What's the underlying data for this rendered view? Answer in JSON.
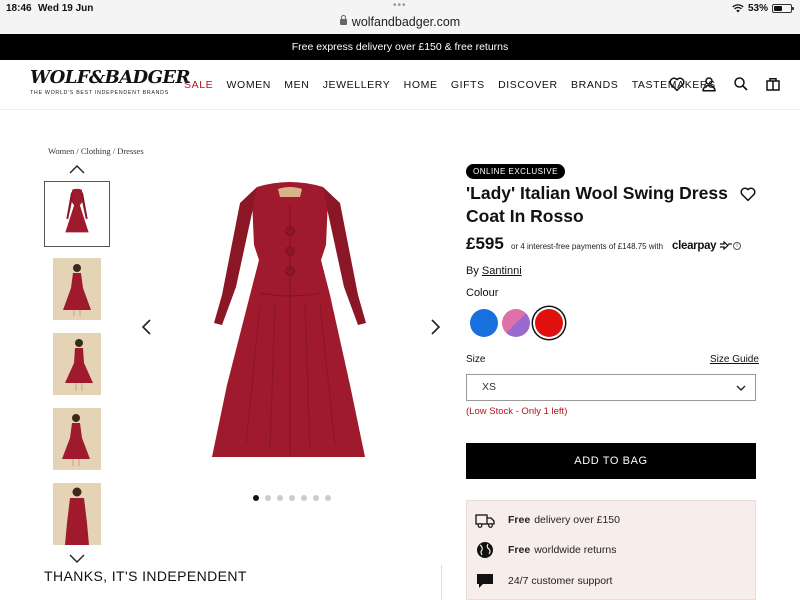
{
  "status_bar": {
    "time": "18:46",
    "date": "Wed 19 Jun",
    "url": "wolfandbadger.com",
    "battery": "53%",
    "battery_level": 0.53
  },
  "promo": {
    "text": "Free express delivery over £150 & free returns"
  },
  "header": {
    "logo": "WOLF&BADGER",
    "tagline": "THE WORLD'S BEST INDEPENDENT BRANDS",
    "nav": [
      "SALE",
      "WOMEN",
      "MEN",
      "JEWELLERY",
      "HOME",
      "GIFTS",
      "DISCOVER",
      "BRANDS",
      "TASTEMAKERS"
    ],
    "icons": [
      "heart-icon",
      "user-icon",
      "search-icon",
      "bag-icon"
    ]
  },
  "breadcrumb": "Women / Clothing / Dresses",
  "gallery": {
    "thumbnail_count": 5,
    "active_thumbnail": 1,
    "dot_count": 7,
    "active_dot": 1
  },
  "product": {
    "badge": "ONLINE EXCLUSIVE",
    "title": "'Lady' Italian Wool Swing Dress Coat In Rosso",
    "price": "£595",
    "installments": "or 4 interest-free payments of £148.75 with",
    "clearpay": "clearpay",
    "by_prefix": "By",
    "brand": "Santinni",
    "colour_label": "Colour",
    "colours": [
      {
        "name": "blue",
        "hex": "#1a6fdf"
      },
      {
        "name": "pink-purple",
        "hex": "#e070a8"
      },
      {
        "name": "red",
        "hex": "#e01010",
        "selected": true
      }
    ],
    "size_label": "Size",
    "size_guide": "Size Guide",
    "size_value": "XS",
    "stock_note": "(Low Stock - Only 1 left)",
    "add_to_bag": "ADD TO BAG"
  },
  "perks": [
    {
      "bold": "Free",
      "text": "delivery over £150",
      "icon": "truck-icon"
    },
    {
      "bold": "Free",
      "text": "worldwide returns",
      "icon": "globe-icon"
    },
    {
      "bold": "",
      "text": "24/7 customer support",
      "icon": "chat-icon"
    }
  ],
  "footer_tagline": "THANKS, IT'S INDEPENDENT",
  "colors": {
    "accent_red": "#b2141b",
    "dress": "#9e1a2c",
    "perks_bg": "#f7eeec"
  }
}
